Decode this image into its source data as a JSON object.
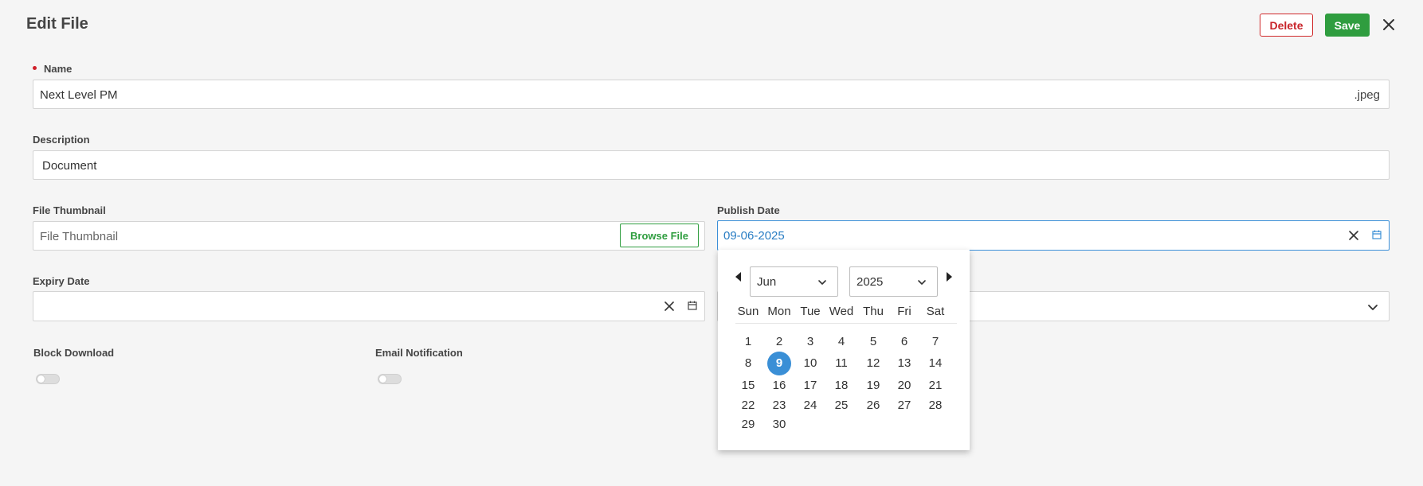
{
  "header": {
    "title": "Edit File",
    "delete_label": "Delete",
    "save_label": "Save"
  },
  "form": {
    "name_label": "Name",
    "name_value": "Next Level PM",
    "name_extension": ".jpeg",
    "description_label": "Description",
    "description_value": "Document",
    "thumbnail_label": "File Thumbnail",
    "thumbnail_placeholder": "File Thumbnail",
    "browse_label": "Browse File",
    "publish_label": "Publish Date",
    "publish_value": "09-06-2025",
    "expiry_label": "Expiry Date",
    "expiry_value": "",
    "block_download_label": "Block Download",
    "block_download_on": false,
    "email_notification_label": "Email Notification",
    "email_notification_on": false
  },
  "datepicker": {
    "month": "Jun",
    "year": "2025",
    "weekdays": [
      "Sun",
      "Mon",
      "Tue",
      "Wed",
      "Thu",
      "Fri",
      "Sat"
    ],
    "weeks": [
      [
        "1",
        "2",
        "3",
        "4",
        "5",
        "6",
        "7"
      ],
      [
        "8",
        "9",
        "10",
        "11",
        "12",
        "13",
        "14"
      ],
      [
        "15",
        "16",
        "17",
        "18",
        "19",
        "20",
        "21"
      ],
      [
        "22",
        "23",
        "24",
        "25",
        "26",
        "27",
        "28"
      ],
      [
        "29",
        "30",
        "",
        "",
        "",
        "",
        ""
      ]
    ],
    "selected_day": "9"
  },
  "colors": {
    "save": "#2f9d3f",
    "delete": "#c8242a",
    "accent": "#3a8fd6"
  }
}
